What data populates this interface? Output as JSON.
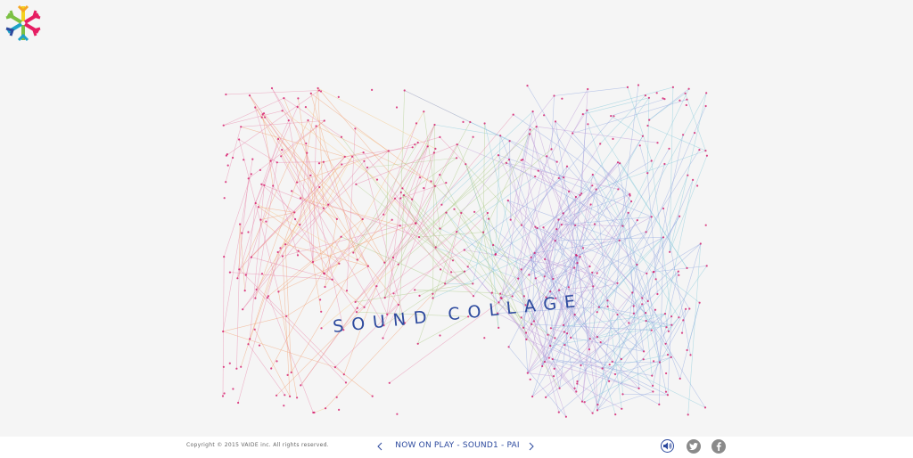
{
  "app": {
    "logo_icon": "snowflake-asterisk-logo-icon",
    "brand_colors": [
      "#e61e63",
      "#f5a623",
      "#f4d21f",
      "#7bc043",
      "#1fa2c9",
      "#2d4a9e"
    ]
  },
  "visual": {
    "title": "SOUND COLLAGE",
    "title_color": "#2d4a9e",
    "palette": [
      "#f29a6a",
      "#f5c37a",
      "#e77fa6",
      "#a8c97f",
      "#7fc6d9",
      "#8aa3de",
      "#b892d6",
      "#e94b8a"
    ],
    "node_color": "#d6186a"
  },
  "footer": {
    "copyright": "Copyright © 2015 VAIDE inc. All rights reserved.",
    "now_playing": "NOW ON PLAY - SOUND1 - PAI",
    "prev_icon": "chevron-left-icon",
    "next_icon": "chevron-right-icon",
    "sound_icon": "speaker-icon",
    "twitter_icon": "twitter-icon",
    "facebook_icon": "facebook-icon",
    "accent": "#2d4a9e",
    "social_color": "#8a8a8a"
  }
}
